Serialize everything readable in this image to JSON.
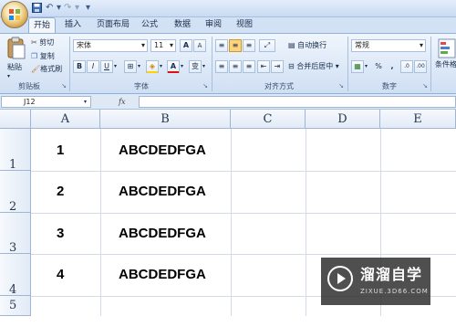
{
  "qat": {
    "undo_icon": "undo-icon",
    "redo_icon": "redo-icon",
    "save_icon": "save-icon",
    "customize_icon": "chevron-down-icon"
  },
  "tabs": [
    {
      "label": "开始",
      "active": true
    },
    {
      "label": "插入"
    },
    {
      "label": "页面布局"
    },
    {
      "label": "公式"
    },
    {
      "label": "数据"
    },
    {
      "label": "审阅"
    },
    {
      "label": "视图"
    }
  ],
  "ribbon": {
    "clipboard": {
      "paste_label": "粘贴",
      "cut_label": "剪切",
      "copy_label": "复制",
      "format_painter_label": "格式刷",
      "group_label": "剪贴板"
    },
    "font": {
      "font_name": "宋体",
      "font_size": "11",
      "bold": "B",
      "italic": "I",
      "underline": "U",
      "grow": "A",
      "shrink": "A",
      "color_a": "A",
      "wen": "变",
      "group_label": "字体"
    },
    "alignment": {
      "wrap_label": "自动换行",
      "merge_label": "合并后居中",
      "group_label": "对齐方式"
    },
    "number": {
      "format_value": "常规",
      "percent": "%",
      "comma": ",",
      "group_label": "数字"
    },
    "styles": {
      "conditional_label": "条件格"
    }
  },
  "formula_bar": {
    "name_box": "J12",
    "fx": "fx",
    "value": ""
  },
  "grid": {
    "columns": [
      "A",
      "B",
      "C",
      "D",
      "E"
    ],
    "rows": [
      "1",
      "2",
      "3",
      "4",
      "5"
    ],
    "cells": [
      {
        "a": "1",
        "b": "ABCDEDFGA"
      },
      {
        "a": "2",
        "b": "ABCDEDFGA"
      },
      {
        "a": "3",
        "b": "ABCDEDFGA"
      },
      {
        "a": "4",
        "b": "ABCDEDFGA"
      }
    ]
  },
  "watermark": {
    "title": "溜溜自学",
    "subtitle": "ZIXUE.3D66.COM"
  }
}
